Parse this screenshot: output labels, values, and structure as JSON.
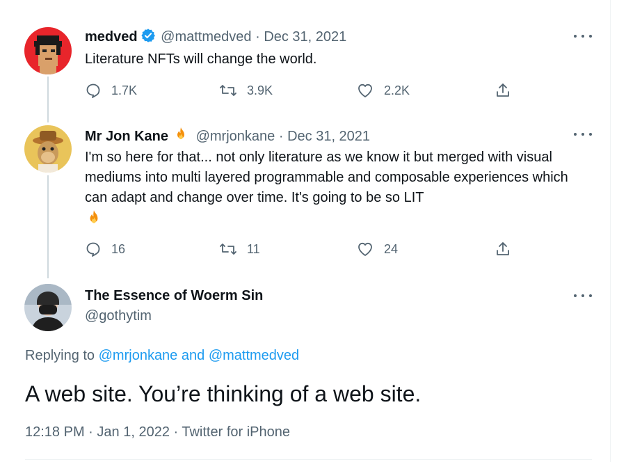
{
  "colors": {
    "link": "#1d9bf0",
    "muted": "#536471",
    "text": "#0f1419",
    "verified": "#1d9bf0",
    "thread_line": "#cfd9de"
  },
  "tweets": [
    {
      "avatar_icon": "pixel-punk-avatar",
      "name": "medved",
      "verified_icon": "verified-badge-icon",
      "handle": "@mattmedved",
      "separator": "·",
      "date": "Dec 31, 2021",
      "text": "Literature NFTs will change the world.",
      "replies": "1.7K",
      "retweets": "3.9K",
      "likes": "2.2K"
    },
    {
      "avatar_icon": "ape-avatar",
      "name": "Mr Jon Kane",
      "name_emoji_icon": "fire-emoji-icon",
      "handle": "@mrjonkane",
      "separator": "·",
      "date": "Dec 31, 2021",
      "text": "I'm so here for that... not only literature as we know it but merged with visual mediums into multi layered programmable and composable experiences which can adapt and change over time. It's going to be so LIT",
      "text_emoji_icon": "fire-emoji-icon",
      "replies": "16",
      "retweets": "11",
      "likes": "24"
    }
  ],
  "focused": {
    "avatar_icon": "masked-person-avatar",
    "name": "The Essence of Woerm Sin",
    "handle": "@gothytim",
    "replying_prefix": "Replying to",
    "reply_handle_1": "@mrjonkane",
    "reply_and": "and",
    "reply_handle_2": "@mattmedved",
    "text": "A web site. You’re thinking of a web site.",
    "time": "12:18 PM",
    "separator": "·",
    "date": "Jan 1, 2022",
    "source": "Twitter for iPhone"
  }
}
